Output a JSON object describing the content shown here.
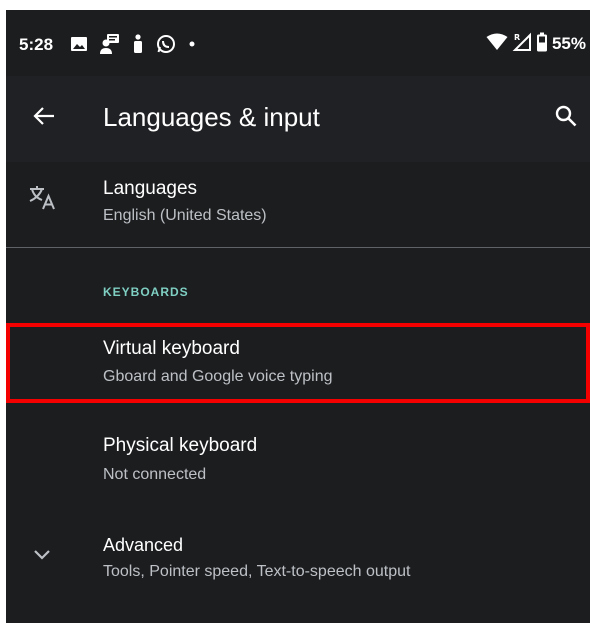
{
  "status_bar": {
    "time": "5:28",
    "icons": [
      "image-icon",
      "person-badge-icon",
      "figure-icon",
      "whatsapp-icon",
      "dot-icon"
    ],
    "right_icons": [
      "wifi-icon",
      "signal-roaming-icon",
      "battery-icon"
    ],
    "battery": "55%"
  },
  "app_bar": {
    "title": "Languages & input",
    "back_icon": "arrow-back-icon",
    "search_icon": "search-icon"
  },
  "items": {
    "languages": {
      "icon": "translate-icon",
      "title": "Languages",
      "subtitle": "English (United States)"
    },
    "section_keyboards": "KEYBOARDS",
    "virtual_keyboard": {
      "title": "Virtual keyboard",
      "subtitle": "Gboard and Google voice typing"
    },
    "physical_keyboard": {
      "title": "Physical keyboard",
      "subtitle": "Not connected"
    },
    "advanced": {
      "icon": "chevron-down-icon",
      "title": "Advanced",
      "subtitle": "Tools, Pointer speed, Text-to-speech output"
    }
  },
  "colors": {
    "background": "#1c1d1f",
    "app_bar": "#202124",
    "accent": "#7fcfc3",
    "highlight": "#f50000",
    "secondary_text": "#bdc1c6"
  }
}
